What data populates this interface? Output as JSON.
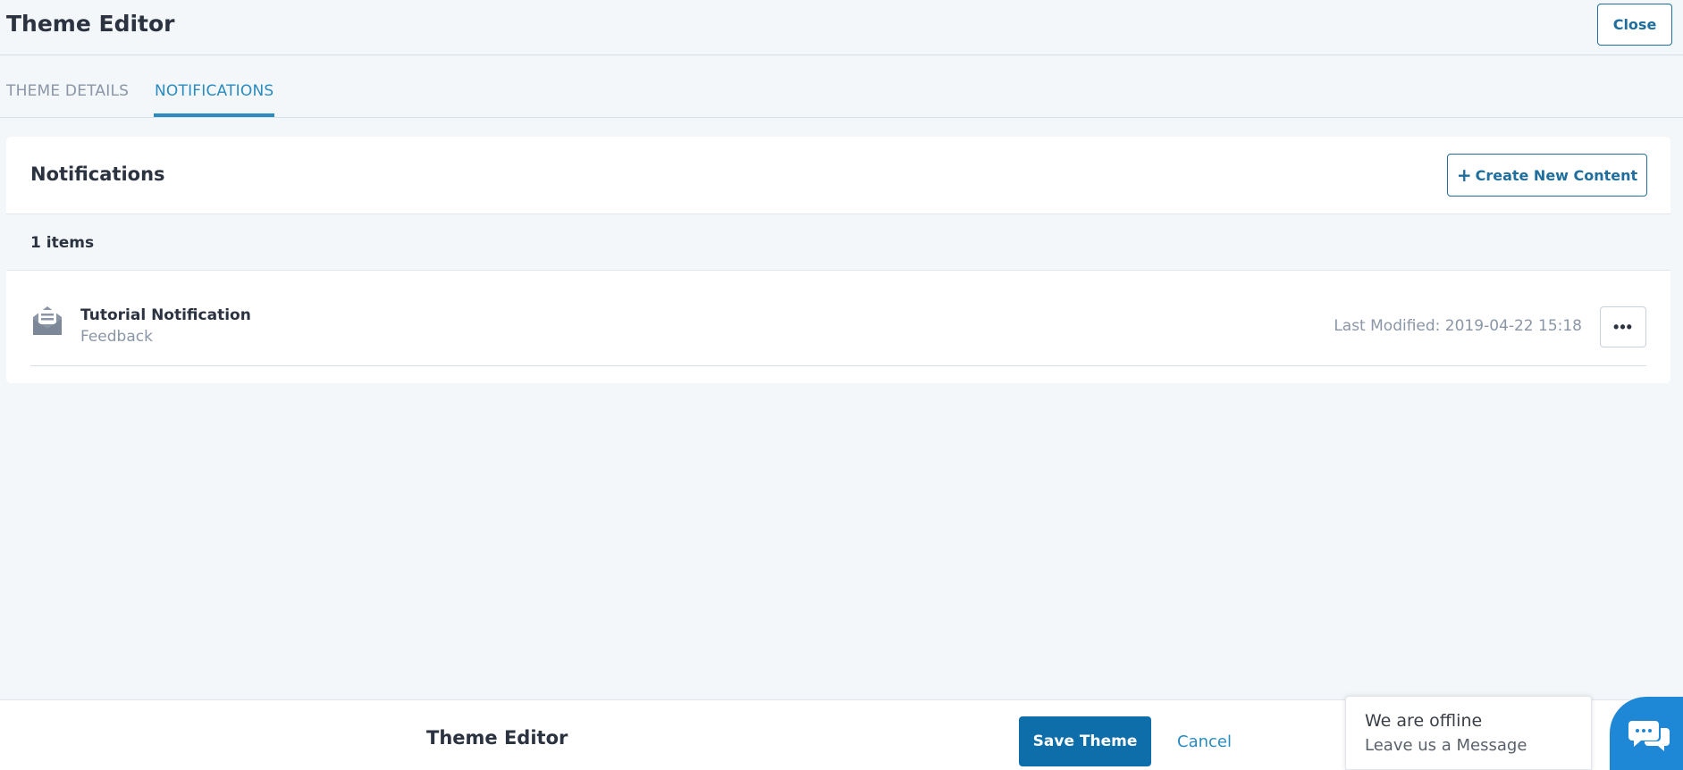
{
  "header": {
    "title": "Theme Editor",
    "close_label": "Close"
  },
  "tabs": [
    {
      "label": "THEME DETAILS",
      "active": false
    },
    {
      "label": "NOTIFICATIONS",
      "active": true
    }
  ],
  "card": {
    "title": "Notifications",
    "create_label": "Create New Content",
    "items_count": "1 items",
    "rows": [
      {
        "icon": "envelope-open-icon",
        "title": "Tutorial Notification",
        "subtitle": "Feedback",
        "modified": "Last Modified: 2019-04-22 15:18"
      }
    ]
  },
  "footer": {
    "title": "Theme Editor",
    "save_label": "Save Theme",
    "cancel_label": "Cancel"
  },
  "chat": {
    "status": "We are offline",
    "message": "Leave us a Message"
  },
  "colors": {
    "accent": "#2a8bbf",
    "primary_button": "#0e6eaa",
    "chat": "#1e88d6"
  }
}
